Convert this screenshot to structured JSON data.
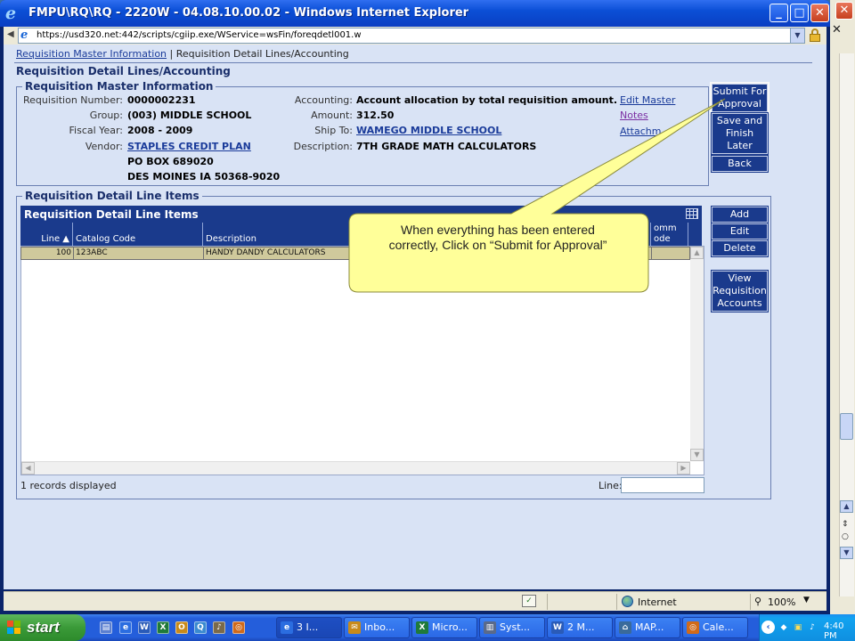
{
  "window": {
    "title": "FMPU\\RQ\\RQ - 2220W - 04.08.10.00.02 - Windows Internet Explorer",
    "minimize_glyph": "_",
    "maximize_glyph": "□",
    "close_glyph": "✕",
    "second_close_glyph": "✕"
  },
  "address": {
    "url": "https://usd320.net:442/scripts/cgiip.exe/WService=wsFin/foreqdetl001.w"
  },
  "breadcrumb": {
    "link": "Requisition Master Information",
    "separator": "|",
    "current": "Requisition Detail Lines/Accounting"
  },
  "page_title": "Requisition Detail Lines/Accounting",
  "master": {
    "legend": "Requisition Master Information",
    "fields_left": [
      {
        "label": "Requisition Number:",
        "value": "0000002231",
        "link": false
      },
      {
        "label": "Group:",
        "value": "(003) MIDDLE SCHOOL",
        "link": false
      },
      {
        "label": "Fiscal Year:",
        "value": "2008 - 2009",
        "link": false
      },
      {
        "label": "Vendor:",
        "value": "STAPLES CREDIT PLAN",
        "link": true
      }
    ],
    "vendor_address": [
      "PO BOX 689020",
      "DES MOINES IA 50368-9020"
    ],
    "fields_right": [
      {
        "label": "Accounting:",
        "value": "Account allocation by total requisition amount.",
        "link": false
      },
      {
        "label": "Amount:",
        "value": "312.50",
        "link": false
      },
      {
        "label": "Ship To:",
        "value": "WAMEGO MIDDLE SCHOOL",
        "link": true
      },
      {
        "label": "Description:",
        "value": "7TH GRADE MATH CALCULATORS",
        "link": false
      }
    ],
    "links": [
      "Edit Master",
      "Notes",
      "Attachm"
    ]
  },
  "side_buttons": {
    "submit": "Submit For Approval",
    "save": "Save and Finish Later",
    "back": "Back",
    "add": "Add",
    "edit": "Edit",
    "delete": "Delete",
    "view": "View Requisition Accounts"
  },
  "lines": {
    "legend": "Requisition Detail Line Items",
    "grid_title": "Requisition Detail Line Items",
    "columns": [
      "Line ▲",
      "Catalog Code",
      "Description",
      "omm",
      "ode"
    ],
    "rows": [
      {
        "line": "100",
        "catalog": "123ABC",
        "description": "HANDY DANDY CALCULATORS"
      }
    ],
    "records": "1 records displayed",
    "line_label": "Line:",
    "line_value": ""
  },
  "callout": {
    "line1": "When everything has been entered",
    "line2": "correctly, Click on “Submit for Approval”"
  },
  "status": {
    "zone": "Internet",
    "zoom": "100%"
  },
  "taskbar": {
    "start": "start",
    "tasks": [
      "3 I...",
      "Inbo...",
      "Micro...",
      "Syst...",
      "2 M...",
      "MAP...",
      "Cale..."
    ],
    "clock": "4:40 PM"
  },
  "colors": {
    "nav_blue": "#1a3a8c",
    "page_bg": "#d9e3f5",
    "callout_fill": "#ffff99",
    "row_highlight": "#cfc99c"
  }
}
